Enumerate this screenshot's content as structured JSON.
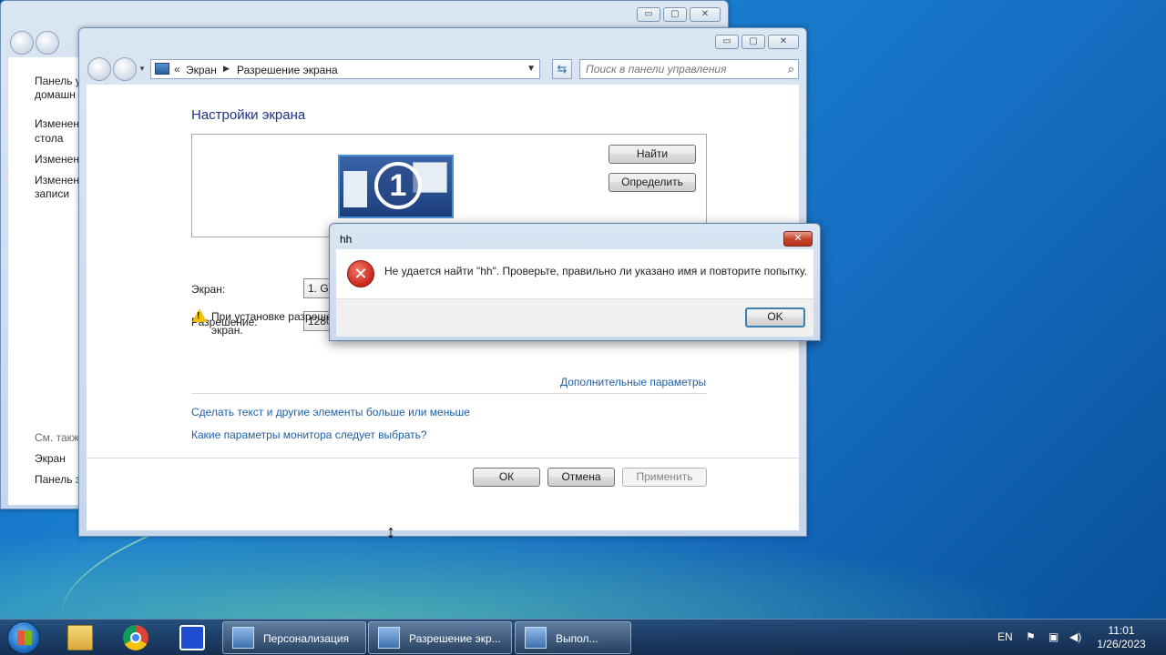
{
  "bg_window": {
    "sidebar": {
      "items": [
        "Панель у",
        "домашн",
        "Изменен",
        "стола",
        "Изменен",
        "Изменен",
        "записи"
      ],
      "see_also_label": "См. такж",
      "see_also_items": [
        "Экран",
        "Панель з"
      ]
    }
  },
  "main_window": {
    "caption": {
      "minimize": "▭",
      "maximize": "▢",
      "close": "✕"
    },
    "address": {
      "chevrons": "«",
      "crumb1": "Экран",
      "crumb2": "Разрешение экрана",
      "sep": "▶",
      "dropdown": "▼"
    },
    "refresh_icon": "⇆",
    "search": {
      "placeholder": "Поиск в панели управления"
    },
    "title": "Настройки экрана",
    "monitor_number": "1",
    "find_button": "Найти",
    "identify_button": "Определить",
    "screen_label": "Экран:",
    "screen_value": "1. Ge",
    "resolution_label": "Разрешение:",
    "resolution_value": "1280",
    "warning_text": "При установке разреше экран.",
    "advanced_link": "Дополнительные параметры",
    "link_text_size": "Сделать текст и другие элементы больше или меньше",
    "link_monitor": "Какие параметры монитора следует выбрать?",
    "ok_button": "ОК",
    "cancel_button": "Отмена",
    "apply_button": "Применить"
  },
  "dialog": {
    "title": "hh",
    "close": "✕",
    "message": "Не удается найти \"hh\". Проверьте, правильно ли указано имя и повторите попытку.",
    "error_glyph": "✕",
    "ok_button": "OK"
  },
  "taskbar": {
    "tasks": [
      {
        "label": "Персонализация"
      },
      {
        "label": "Разрешение экр..."
      },
      {
        "label": "Выпол..."
      }
    ],
    "language": "EN",
    "time": "11:01",
    "date": "1/26/2023"
  },
  "colors": {
    "link": "#1e5fa8",
    "title_blue": "#1e3287",
    "error_red": "#c8251a",
    "warning_yellow": "#f2c200"
  }
}
